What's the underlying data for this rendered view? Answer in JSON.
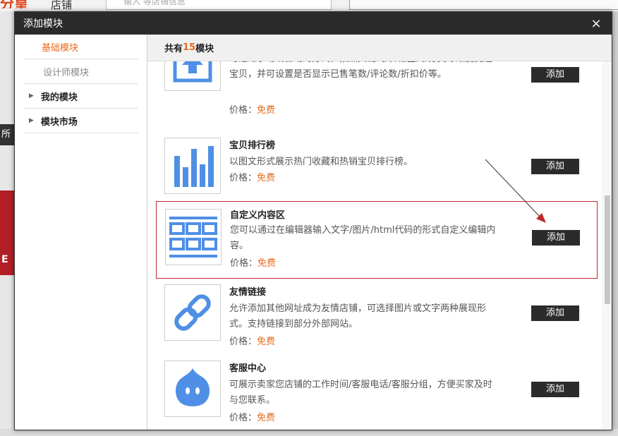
{
  "background": {
    "logo_text": "分皇",
    "logo_suffix": "店铺",
    "search_text": "输入 等店铺信息",
    "left_label": "所",
    "banner_text": "E"
  },
  "dialog": {
    "title": "添加模块",
    "close_symbol": "×"
  },
  "sidebar": {
    "items": [
      {
        "label": "基础模块",
        "active": true
      },
      {
        "label": "设计师模块",
        "active": false
      },
      {
        "label": "我的模块",
        "group": true
      },
      {
        "label": "模块市场",
        "group": true
      }
    ]
  },
  "main": {
    "header_prefix": "共有",
    "header_count": "15",
    "header_suffix": "模块",
    "price_label": "价格：",
    "price_value": "免费",
    "add_label": "添加",
    "modules": [
      {
        "name": "",
        "desc": "可通过手动或自动的方式，按照关键词/价格区间/分类等维度挑选宝贝，并可设置是否显示已售笔数/评论数/折扣价等。",
        "icon": "upload-icon"
      },
      {
        "name": "宝贝排行榜",
        "desc": "以图文形式展示热门收藏和热销宝贝排行榜。",
        "icon": "bar-chart-icon"
      },
      {
        "name": "自定义内容区",
        "desc": "您可以通过在编辑器输入文字/图片/html代码的形式自定义编辑内容。",
        "icon": "grid-icon"
      },
      {
        "name": "友情链接",
        "desc": "允许添加其他网址成为友情店铺，可选择图片或文字两种展现形式。支持链接到部分外部网站。",
        "icon": "link-icon"
      },
      {
        "name": "客服中心",
        "desc": "可展示卖家您店铺的工作时间/客服电话/客服分组，方便买家及时与您联系。",
        "icon": "chat-bubble-icon"
      }
    ]
  },
  "colors": {
    "accent": "#e66b1e",
    "highlight_border": "#c0272d",
    "icon_blue": "#4f8fe6",
    "dark": "#2b2b2b"
  }
}
